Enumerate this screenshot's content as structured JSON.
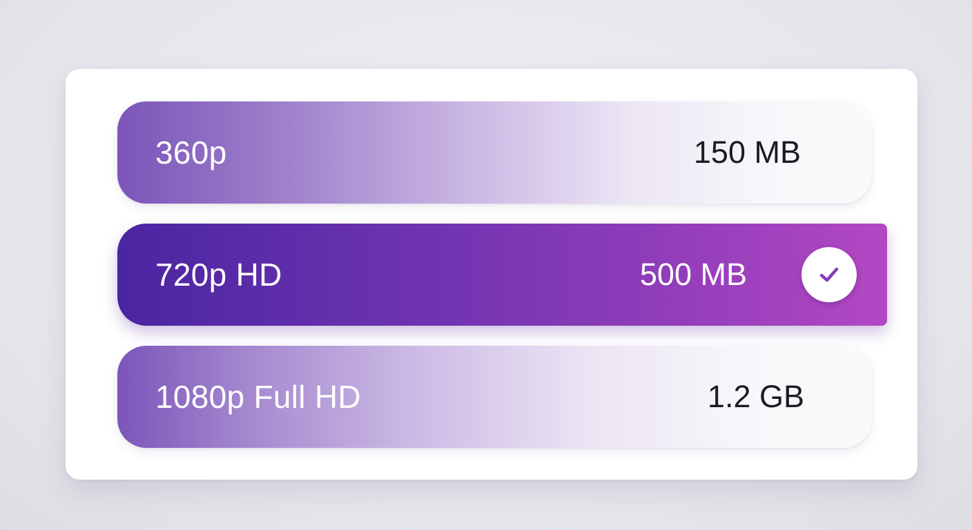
{
  "options": [
    {
      "label": "360p",
      "size": "150 MB",
      "selected": false
    },
    {
      "label": "720p HD",
      "size": "500 MB",
      "selected": true
    },
    {
      "label": "1080p Full HD",
      "size": "1.2 GB",
      "selected": false
    }
  ],
  "icons": {
    "selected_indicator": "checkmark-icon"
  },
  "colors": {
    "accent_start": "#4a25a2",
    "accent_end": "#b347c3",
    "check_stroke": "#8a3bb8"
  }
}
